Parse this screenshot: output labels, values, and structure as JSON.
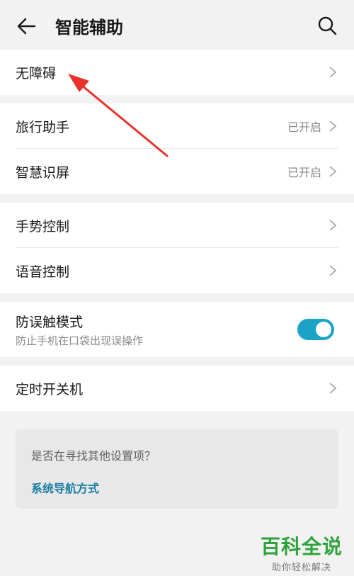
{
  "header": {
    "title": "智能辅助",
    "back_icon": "arrow-left-icon",
    "search_icon": "search-icon"
  },
  "sections": {
    "accessibility": {
      "label": "无障碍"
    },
    "travel": {
      "label": "旅行助手",
      "status": "已开启"
    },
    "smart_screen": {
      "label": "智慧识屏",
      "status": "已开启"
    },
    "gesture": {
      "label": "手势控制"
    },
    "voice": {
      "label": "语音控制"
    },
    "mistouch": {
      "label": "防误触模式",
      "sub": "防止手机在口袋出现误操作",
      "enabled": true
    },
    "timer_power": {
      "label": "定时开关机"
    }
  },
  "suggestion": {
    "question": "是否在寻找其他设置项？",
    "link": "系统导航方式"
  },
  "watermark": {
    "title": "百科全说",
    "subtitle": "助你轻松解决"
  },
  "colors": {
    "accent": "#1aa3c9",
    "link": "#1a7ea3",
    "annotation_arrow": "#e8322b",
    "watermark": "#2fa33b"
  }
}
